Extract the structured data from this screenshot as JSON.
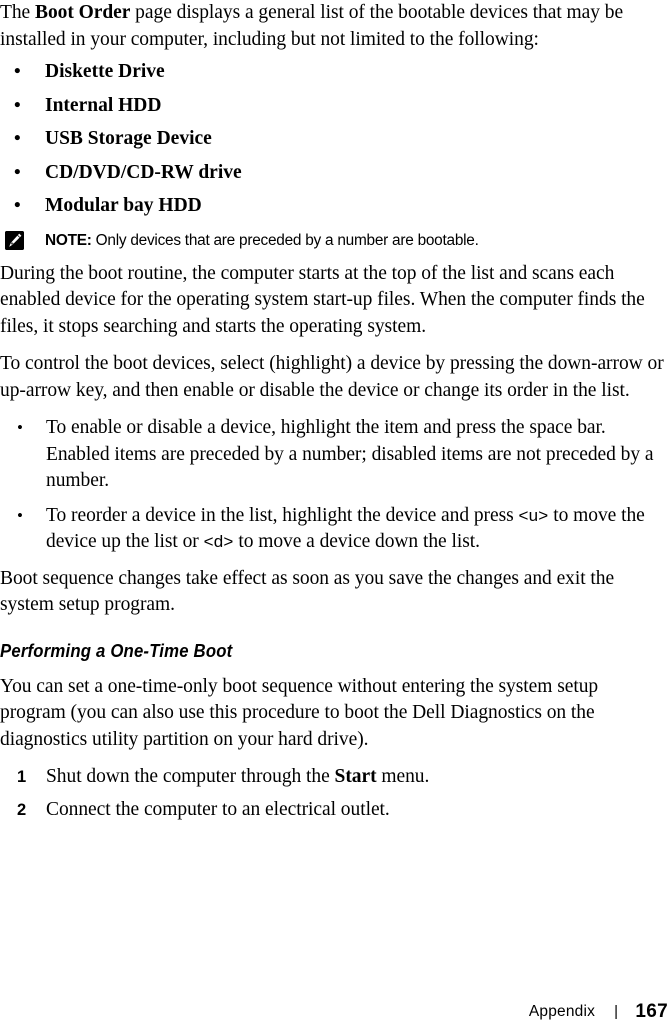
{
  "document": {
    "intro_paragraph_prefix": "The ",
    "intro_bold_term": "Boot Order",
    "intro_paragraph_rest": " page displays a general list of the bootable devices that may be installed in your computer, including but not limited to the following:",
    "device_list": [
      {
        "bullet": "•",
        "label": "Diskette Drive"
      },
      {
        "bullet": "•",
        "label": "Internal HDD"
      },
      {
        "bullet": "•",
        "label": "USB Storage Device"
      },
      {
        "bullet": "•",
        "label": "CD/DVD/CD-RW drive"
      },
      {
        "bullet": "•",
        "label": "Modular bay HDD"
      }
    ],
    "note": {
      "icon": "note-pencil-icon",
      "label": "NOTE:",
      "text": " Only devices that are preceded by a number are bootable."
    },
    "paragraph_boot_routine": "During the boot routine, the computer starts at the top of the list and scans each enabled device for the operating system start-up files. When the computer finds the files, it stops searching and starts the operating system.",
    "paragraph_control_devices": "To control the boot devices, select (highlight) a device by pressing the down-arrow or up-arrow key, and then enable or disable the device or change its order in the list.",
    "instruction_bullets": [
      {
        "bullet": "•",
        "text": "To enable or disable a device, highlight the item and press the space bar. Enabled items are preceded by a number; disabled items are not preceded by a number."
      },
      {
        "bullet": "•",
        "text_part1": "To reorder a device in the list, highlight the device and press ",
        "key1": "<u>",
        "text_part2": " to move the device up the list or ",
        "key2": "<d>",
        "text_part3": " to move a device down the list."
      }
    ],
    "paragraph_boot_sequence": "Boot sequence changes take effect as soon as you save the changes and exit the system setup program.",
    "subheading": "Performing a One-Time Boot",
    "paragraph_one_time_prefix": "You can set a one-time-only boot sequence without entering the system setup program (you can also use this procedure to boot the Dell Diagnostics on the diagnostics utility partition on your hard drive).",
    "numbered_steps": [
      {
        "number": "1",
        "text_prefix": "Shut down the computer through the ",
        "bold_term": "Start",
        "text_suffix": " menu."
      },
      {
        "number": "2",
        "text_prefix": "Connect the computer to an electrical outlet.",
        "bold_term": "",
        "text_suffix": ""
      }
    ]
  },
  "footer": {
    "chapter": "Appendix",
    "separator": "|",
    "page_number": "167"
  },
  "colors": {
    "text": "#000000",
    "background": "#ffffff",
    "note_icon_background": "#000000",
    "note_icon_glyph": "#ffffff"
  }
}
